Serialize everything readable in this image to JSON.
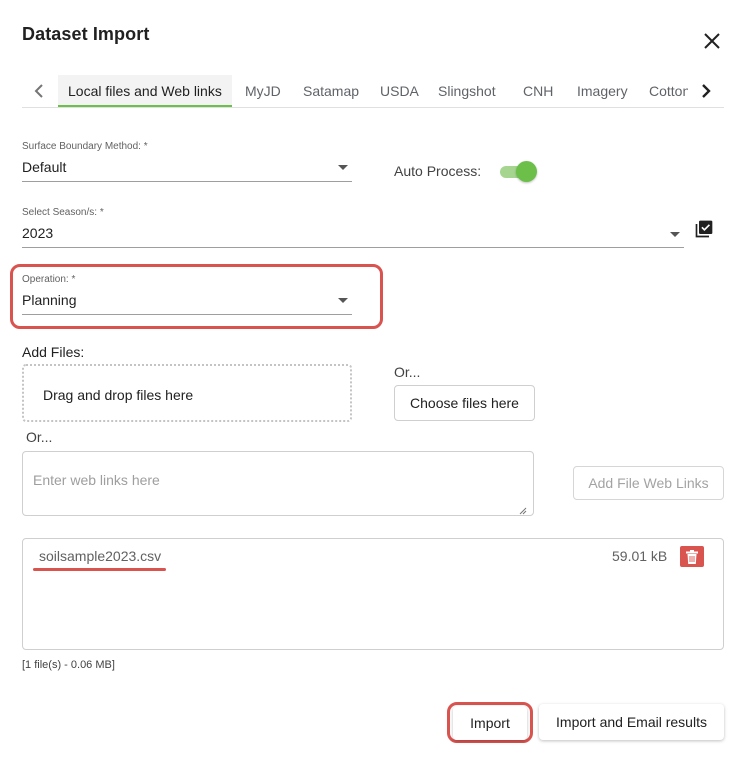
{
  "dialog": {
    "title": "Dataset Import"
  },
  "tabs": [
    {
      "label": "Local files and Web links",
      "active": true
    },
    {
      "label": "MyJD"
    },
    {
      "label": "Satamap"
    },
    {
      "label": "USDA"
    },
    {
      "label": "Slingshot"
    },
    {
      "label": "CNH"
    },
    {
      "label": "Imagery"
    },
    {
      "label": "Cotton"
    }
  ],
  "surface_boundary": {
    "label": "Surface Boundary Method: *",
    "value": "Default"
  },
  "auto_process": {
    "label": "Auto Process:",
    "enabled": true
  },
  "season": {
    "label": "Select Season/s: *",
    "value": "2023"
  },
  "operation": {
    "label": "Operation: *",
    "value": "Planning"
  },
  "add_files": {
    "label": "Add Files:",
    "dropzone_text": "Drag and drop files here",
    "or1": "Or...",
    "choose_button": "Choose files here",
    "or2": "Or...",
    "weblinks_placeholder": "Enter web links here",
    "add_weblinks_button": "Add File Web Links"
  },
  "file_list": {
    "files": [
      {
        "name": "soilsample2023.csv",
        "size": "59.01 kB"
      }
    ],
    "summary": "[1 file(s) - 0.06 MB]"
  },
  "actions": {
    "import": "Import",
    "import_email": "Import and Email results"
  },
  "colors": {
    "accent_green": "#6cc04a",
    "highlight_red": "#d9534f"
  }
}
